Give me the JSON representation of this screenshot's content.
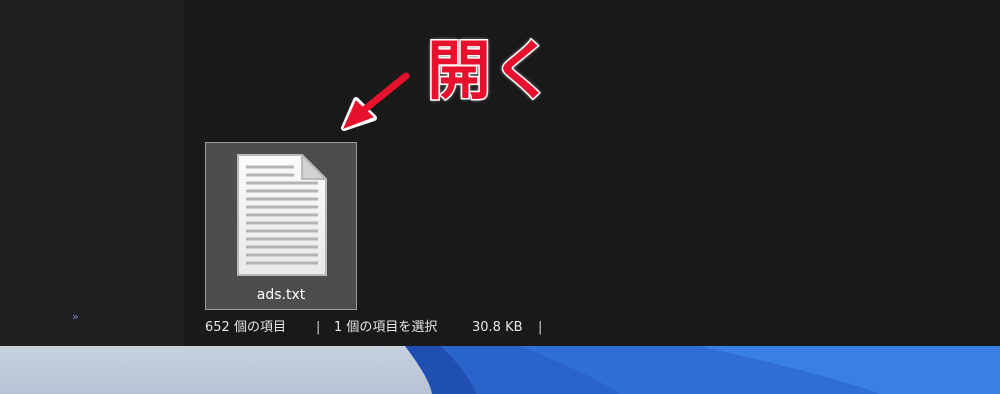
{
  "nav": {
    "expand_glyph": "»"
  },
  "file": {
    "name": "ads.txt",
    "icon": "text-document-icon"
  },
  "status": {
    "item_count": "652 個の項目",
    "separator": "|",
    "selected": "1 個の項目を選択",
    "size": "30.8 KB"
  },
  "annotation": {
    "label": "開く",
    "arrow_icon": "red-arrow-icon",
    "color": "#e8112d"
  },
  "colors": {
    "window_bg": "#191919",
    "nav_bg": "#202020",
    "selection_bg": "#4d4d4d",
    "selection_border": "#9a9a9a"
  }
}
